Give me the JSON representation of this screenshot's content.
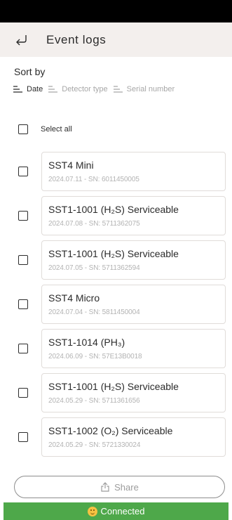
{
  "header": {
    "title": "Event logs",
    "back_icon": "back-arrow-icon"
  },
  "sort": {
    "label": "Sort by",
    "options": [
      {
        "label": "Date",
        "active": true
      },
      {
        "label": "Detector type",
        "active": false
      },
      {
        "label": "Serial number",
        "active": false
      }
    ]
  },
  "select_all": {
    "label": "Select all",
    "checked": false
  },
  "logs": [
    {
      "name": "SST4 Mini",
      "meta": "2024.07.11 - SN: 6011450005",
      "checked": false
    },
    {
      "name": "SST1-1001 (H₂S) Serviceable",
      "meta": "2024.07.08 - SN: 5711362075",
      "checked": false
    },
    {
      "name": "SST1-1001 (H₂S) Serviceable",
      "meta": "2024.07.05 - SN: 5711362594",
      "checked": false
    },
    {
      "name": "SST4 Micro",
      "meta": "2024.07.04 - SN: 5811450004",
      "checked": false
    },
    {
      "name": "SST1-1014 (PH₃)",
      "meta": "2024.06.09 - SN: 57E13B0018",
      "checked": false
    },
    {
      "name": "SST1-1001 (H₂S) Serviceable",
      "meta": "2024.05.29 - SN: 5711361656",
      "checked": false
    },
    {
      "name": "SST1-1002 (O₂) Serviceable",
      "meta": "2024.05.29 - SN: 5721330024",
      "checked": false
    }
  ],
  "footer": {
    "share_label": "Share",
    "share_icon": "share-icon",
    "status_label": "Connected",
    "status_icon": "smile-icon",
    "status_color": "#4ea84a"
  }
}
